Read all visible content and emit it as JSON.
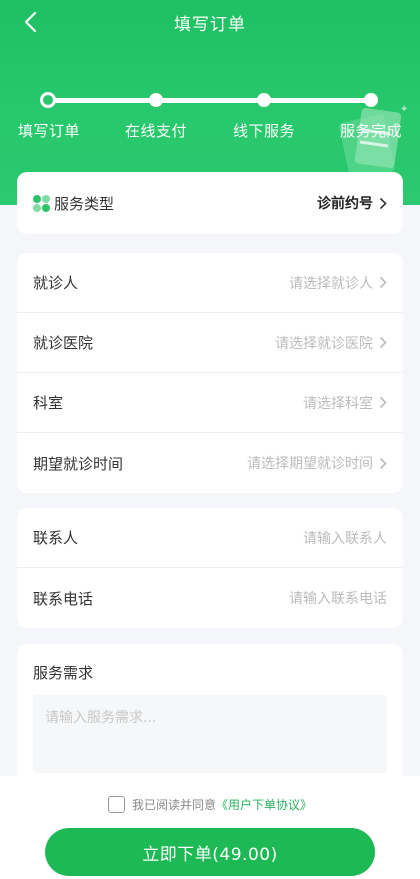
{
  "nav": {
    "title": "填写订单"
  },
  "steps": [
    {
      "label": "填写订单"
    },
    {
      "label": "在线支付"
    },
    {
      "label": "线下服务"
    },
    {
      "label": "服务完成"
    }
  ],
  "service_type": {
    "label": "服务类型",
    "value": "诊前约号"
  },
  "patient_card": {
    "rows": [
      {
        "label": "就诊人",
        "placeholder": "请选择就诊人"
      },
      {
        "label": "就诊医院",
        "placeholder": "请选择就诊医院"
      },
      {
        "label": "科室",
        "placeholder": "请选择科室"
      },
      {
        "label": "期望就诊时间",
        "placeholder": "请选择期望就诊时间"
      }
    ]
  },
  "contact_card": {
    "rows": [
      {
        "label": "联系人",
        "placeholder": "请输入联系人"
      },
      {
        "label": "联系电话",
        "placeholder": "请输入联系电话"
      }
    ]
  },
  "demand": {
    "label": "服务需求",
    "placeholder": "请输入服务需求..."
  },
  "agreement": {
    "text": "我已阅读并同意",
    "link": "《用户下单协议》"
  },
  "submit": {
    "label": "立即下单(49.00)"
  },
  "colors": {
    "brand": "#1db954",
    "header": "#28c86c"
  }
}
